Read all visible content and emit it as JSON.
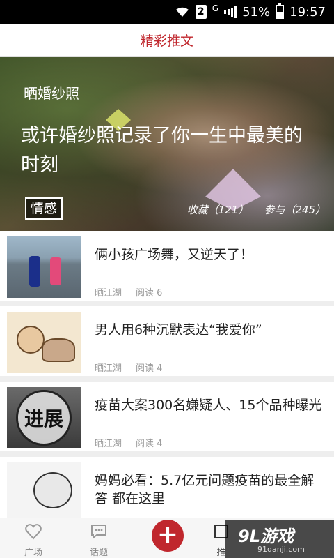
{
  "status_bar": {
    "sim": "2",
    "network": "G",
    "battery": "51%",
    "time": "19:57"
  },
  "header": {
    "title": "精彩推文"
  },
  "hero": {
    "tag": "晒婚纱照",
    "headline": "或许婚纱照记录了你一生中最美的时刻",
    "category": "情感",
    "favorites": "收藏（121）",
    "participants": "参与（245）"
  },
  "articles": [
    {
      "title": "俩小孩广场舞，又逆天了！",
      "author": "晒江湖",
      "reads": "阅读 6"
    },
    {
      "title": "男人用6种沉默表达“我爱你”",
      "author": "晒江湖",
      "reads": "阅读 4"
    },
    {
      "title": "疫苗大案300名嫌疑人、15个品种曝光",
      "author": "晒江湖",
      "reads": "阅读 4",
      "thumb_text": "进展"
    },
    {
      "title": "妈妈必看：5.7亿元问题疫苗的最全解答 都在这里",
      "author": "",
      "reads": ""
    }
  ],
  "tabs": [
    {
      "label": "广场",
      "icon": "heart-icon"
    },
    {
      "label": "话题",
      "icon": "chat-bubble-icon"
    },
    {
      "label": "推",
      "icon": "recommend-icon"
    }
  ],
  "fab": {
    "label": "+",
    "color": "#c0272d"
  },
  "watermark": {
    "brand": "9L游戏",
    "url": "91danji.com"
  },
  "colors": {
    "accent": "#c0272d"
  }
}
